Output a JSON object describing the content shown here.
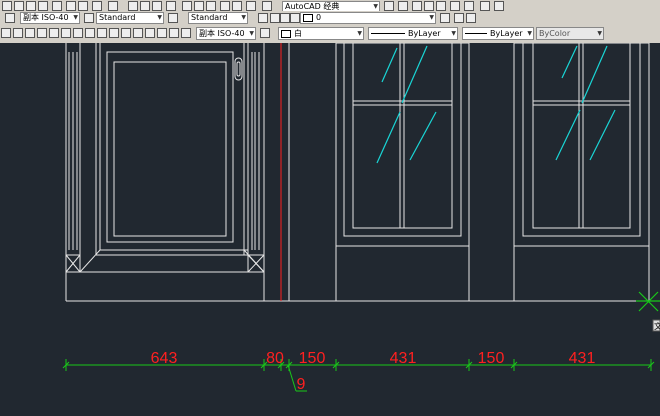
{
  "toolbar_row1": {
    "workspace": "AutoCAD 经典"
  },
  "toolbar_row2": {
    "dim_style": "副本 ISO-40",
    "text_style": "Standard",
    "table_style": "Standard",
    "layer": "0"
  },
  "toolbar_row3": {
    "dim_style": "副本 ISO-40",
    "color_label": "白",
    "linetype": "ByLayer",
    "lineweight": "ByLayer",
    "plotstyle": "ByColor"
  },
  "drawing": {
    "dimensions": [
      "643",
      "80",
      "150",
      "431",
      "150",
      "431",
      "9"
    ],
    "colors": {
      "background": "#212830",
      "geometry": "#e6e6e6",
      "glass": "#19d6d6",
      "dimension_line": "#19c819",
      "dimension_text": "#ff2020",
      "center_line": "#ff2020"
    }
  },
  "ucs_tooltip": "文"
}
